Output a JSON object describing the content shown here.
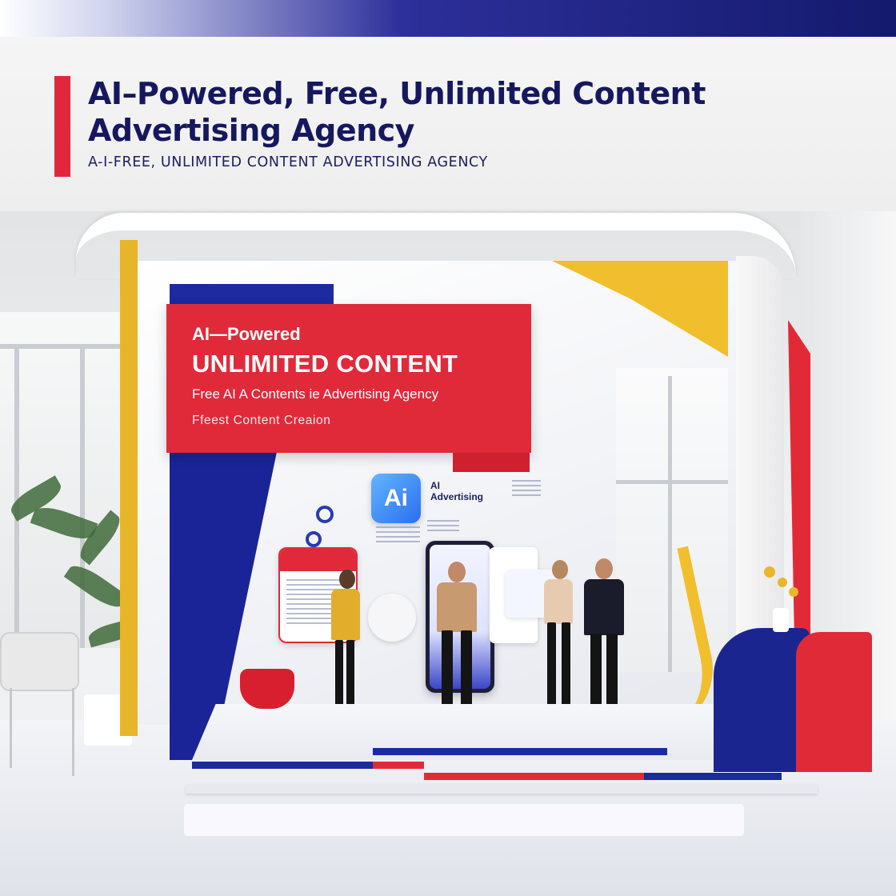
{
  "header": {
    "headline_line1": "AI–Powered, Free, Unlimited Content",
    "headline_line2": "Advertising Agency",
    "subline": "A-I-FREE, UNLIMITED CONTENT ADVERTISING AGENCY"
  },
  "banner": {
    "line1": "AI—Powered",
    "line2": "UNLIMITED CONTENT",
    "line3": "Free AI A Contents ie Advertising Agency",
    "line4": "Ffeest Content Creaion"
  },
  "ai_logo": {
    "label": "Ai",
    "caption_line1": "AI",
    "caption_line2": "Advertising"
  },
  "colors": {
    "navy": "#16185f",
    "brand_red": "#e02a3a",
    "brand_blue": "#1a2497",
    "brand_yellow": "#f1bf2e"
  }
}
